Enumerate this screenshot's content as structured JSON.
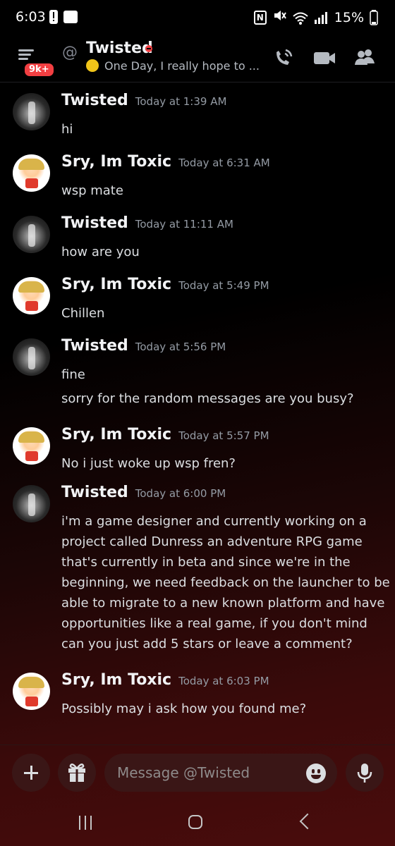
{
  "status_bar": {
    "time": "6:03",
    "nfc": "N",
    "battery": "15%",
    "icons": [
      "alert-icon",
      "app-notification-icon",
      "nfc-icon",
      "mute-icon",
      "wifi-icon",
      "signal-icon",
      "battery-icon"
    ]
  },
  "header": {
    "menu_badge": "9k+",
    "at_symbol": "@",
    "title": "Twisted",
    "status": "do-not-disturb",
    "status_color": "#f23f42",
    "subtitle": "One Day, I really hope to ...",
    "buttons": [
      "voice-call-icon",
      "video-call-icon",
      "members-icon"
    ]
  },
  "messages": [
    {
      "author": "Twisted",
      "avatar": "twisted",
      "time": "Today at 1:39 AM",
      "lines": [
        "hi"
      ]
    },
    {
      "author": "Sry, Im Toxic",
      "avatar": "toxic",
      "time": "Today at 6:31 AM",
      "lines": [
        "wsp mate"
      ]
    },
    {
      "author": "Twisted",
      "avatar": "twisted",
      "time": "Today at 11:11 AM",
      "lines": [
        "how are you"
      ]
    },
    {
      "author": "Sry, Im Toxic",
      "avatar": "toxic",
      "time": "Today at 5:49 PM",
      "lines": [
        "Chillen"
      ]
    },
    {
      "author": "Twisted",
      "avatar": "twisted",
      "time": "Today at 5:56 PM",
      "lines": [
        "fine",
        "sorry for the random messages are you busy?"
      ]
    },
    {
      "author": "Sry, Im Toxic",
      "avatar": "toxic",
      "time": "Today at 5:57 PM",
      "lines": [
        "No i just woke up wsp fren?"
      ]
    },
    {
      "author": "Twisted",
      "avatar": "twisted",
      "time": "Today at 6:00 PM",
      "lines": [
        "i'm a game designer and currently working on a",
        "project called Dunress  an adventure RPG game",
        "that's currently in beta and since we're in the",
        "beginning, we need feedback on the launcher to be",
        "able to migrate to a new known platform and have",
        "opportunities like a real game, if you don't mind",
        "can you just add 5 stars or leave a comment?"
      ]
    },
    {
      "author": "Sry, Im Toxic",
      "avatar": "toxic",
      "time": "Today at 6:03 PM",
      "lines": [
        "Possibly may i ask how you found me?"
      ]
    }
  ],
  "composer": {
    "placeholder": "Message @Twisted",
    "buttons": [
      "plus-icon",
      "gift-icon",
      "emoji-icon",
      "microphone-icon"
    ]
  },
  "colors": {
    "accent_red": "#f23f42",
    "input_bg": "#3a1616",
    "muted_text": "#949ba4"
  }
}
